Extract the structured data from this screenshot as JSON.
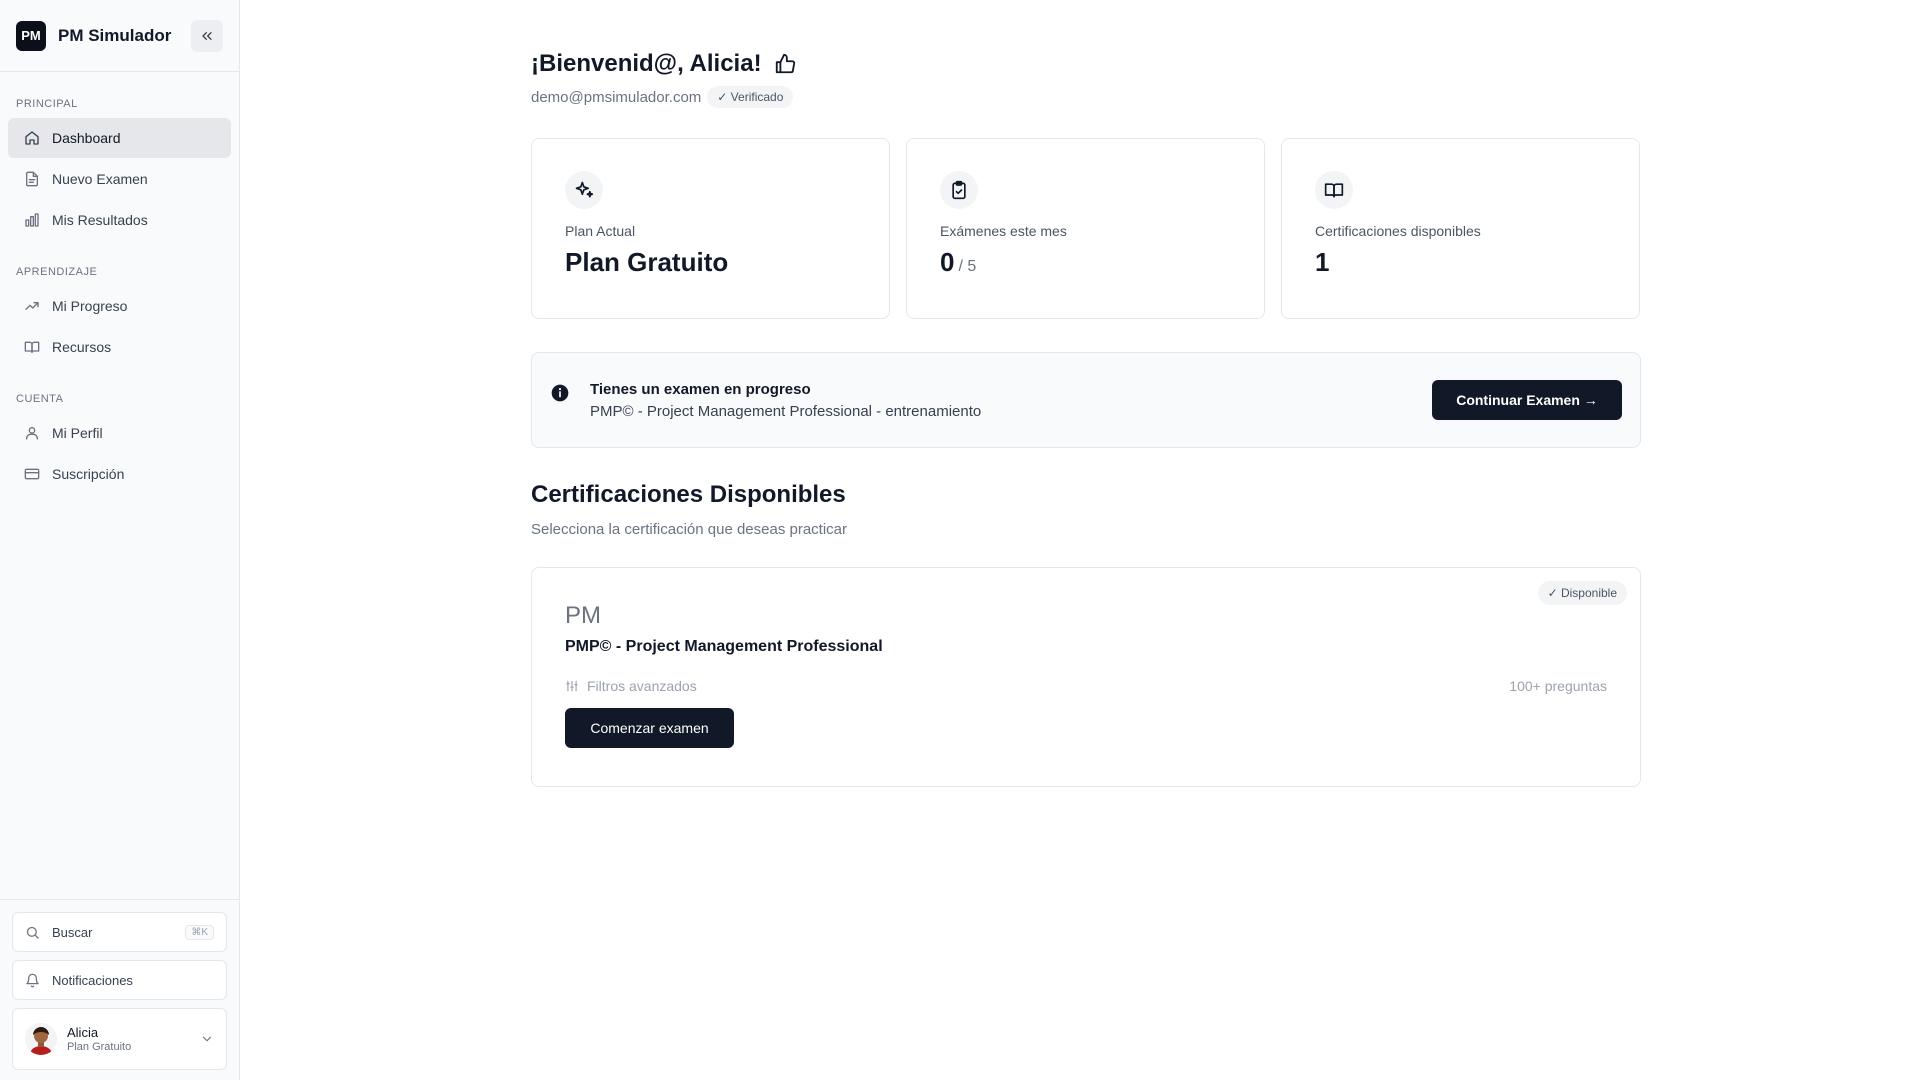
{
  "app": {
    "logo_text": "PM",
    "name": "PM Simulador"
  },
  "sidebar": {
    "sections": [
      {
        "title": "PRINCIPAL",
        "items": [
          {
            "label": "Dashboard",
            "icon": "home-icon"
          },
          {
            "label": "Nuevo Examen",
            "icon": "file-icon"
          },
          {
            "label": "Mis Resultados",
            "icon": "bar-chart-icon"
          }
        ]
      },
      {
        "title": "APRENDIZAJE",
        "items": [
          {
            "label": "Mi Progreso",
            "icon": "trending-up-icon"
          },
          {
            "label": "Recursos",
            "icon": "book-icon"
          }
        ]
      },
      {
        "title": "CUENTA",
        "items": [
          {
            "label": "Mi Perfil",
            "icon": "user-icon"
          },
          {
            "label": "Suscripción",
            "icon": "credit-card-icon"
          }
        ]
      }
    ],
    "active_item": "Dashboard",
    "search": {
      "label": "Buscar",
      "shortcut": "⌘K"
    },
    "notifications_label": "Notificaciones",
    "user": {
      "name": "Alicia",
      "plan": "Plan Gratuito"
    }
  },
  "header": {
    "greeting": "¡Bienvenid@, Alicia!",
    "email": "demo@pmsimulador.com",
    "verified_badge": "✓ Verificado"
  },
  "stats": [
    {
      "label": "Plan Actual",
      "value": "Plan Gratuito",
      "sub": "",
      "icon": "sparkles-icon"
    },
    {
      "label": "Exámenes este mes",
      "value": "0",
      "sub": "/ 5",
      "icon": "clipboard-check-icon"
    },
    {
      "label": "Certificaciones disponibles",
      "value": "1",
      "sub": "",
      "icon": "open-book-icon"
    }
  ],
  "progress_banner": {
    "title": "Tienes un examen en progreso",
    "description": "PMP© - Project Management Professional - entrenamiento",
    "button_label": "Continuar Examen →"
  },
  "certifications": {
    "title": "Certificaciones Disponibles",
    "subtitle": "Selecciona la certificación que deseas practicar",
    "items": [
      {
        "badge": "✓ Disponible",
        "abbr": "PM",
        "name": "PMP© - Project Management Professional",
        "filters_label": "Filtros avanzados",
        "question_count": "100+ preguntas",
        "button_label": "Comenzar examen"
      }
    ]
  },
  "colors": {
    "primary_dark": "#111827",
    "sidebar_bg": "#f9fafb",
    "border": "#e5e7eb",
    "muted_text": "#6b7280"
  }
}
